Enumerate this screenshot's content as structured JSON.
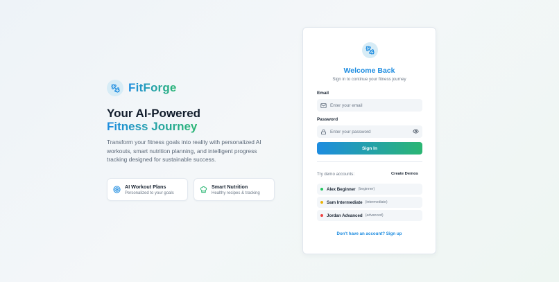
{
  "brand": {
    "name": "FitForge",
    "logo_icon": "dumbbell-icon"
  },
  "hero": {
    "title_line1": "Your AI-Powered",
    "title_line2": "Fitness Journey",
    "description": "Transform your fitness goals into reality with personalized AI workouts, smart nutrition planning, and intelligent progress tracking designed for sustainable success."
  },
  "features": [
    {
      "title": "AI Workout Plans",
      "subtitle": "Personalized to your goals",
      "icon": "target-icon"
    },
    {
      "title": "Smart Nutrition",
      "subtitle": "Healthy recipes & tracking",
      "icon": "chef-hat-icon"
    }
  ],
  "login": {
    "title": "Welcome Back",
    "subtitle": "Sign in to continue your fitness journey",
    "email_label": "Email",
    "email_placeholder": "Enter your email",
    "email_value": "",
    "password_label": "Password",
    "password_placeholder": "Enter your password",
    "password_value": "",
    "signin_label": "Sign In",
    "demo_label": "Try demo accounts:",
    "create_demos_label": "Create Demos",
    "demo_accounts": [
      {
        "name": "Alex Beginner",
        "level": "(beginner)",
        "color": "#22c55e"
      },
      {
        "name": "Sam Intermediate",
        "level": "(intermediate)",
        "color": "#eab308"
      },
      {
        "name": "Jordan Advanced",
        "level": "(advanced)",
        "color": "#ef4444"
      }
    ],
    "signup_text": "Don't have an account? Sign up"
  },
  "colors": {
    "primary": "#1d8ce0",
    "accent": "#2bb673"
  }
}
